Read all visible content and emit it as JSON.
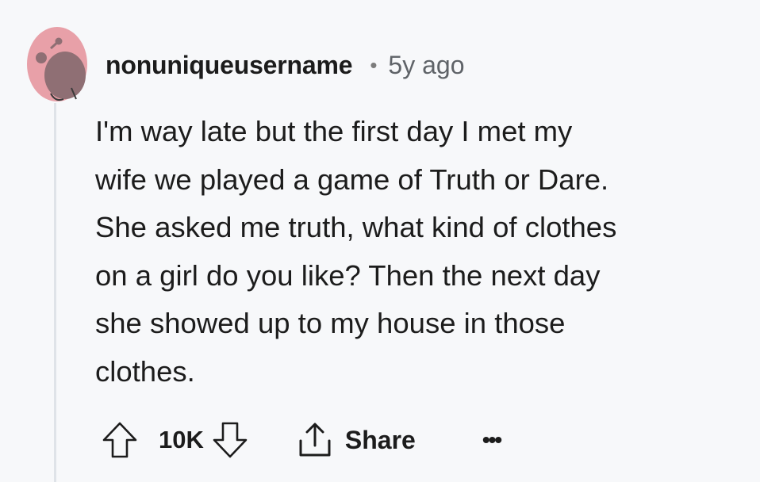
{
  "comment": {
    "username": "nonuniqueusername",
    "separator": "•",
    "timestamp": "5y ago",
    "body_lines": [
      "I'm way late but the first day I met my",
      "wife we played a game of Truth or Dare.",
      "She asked me truth, what kind of clothes",
      "on a girl do you like? Then the next day",
      "she showed up to my house in those",
      "clothes."
    ],
    "score": "10K",
    "share_label": "Share",
    "more_label": "•••"
  },
  "colors": {
    "background": "#f7f8fa",
    "avatar_bg": "#e8a0a8",
    "thread_line": "#dfe3e8",
    "text": "#1c1c1c",
    "muted": "#5f6368"
  },
  "icons": {
    "avatar": "snoo-avatar",
    "upvote": "arrow-up-icon",
    "downvote": "arrow-down-icon",
    "share": "share-icon",
    "more": "more-options-icon"
  }
}
